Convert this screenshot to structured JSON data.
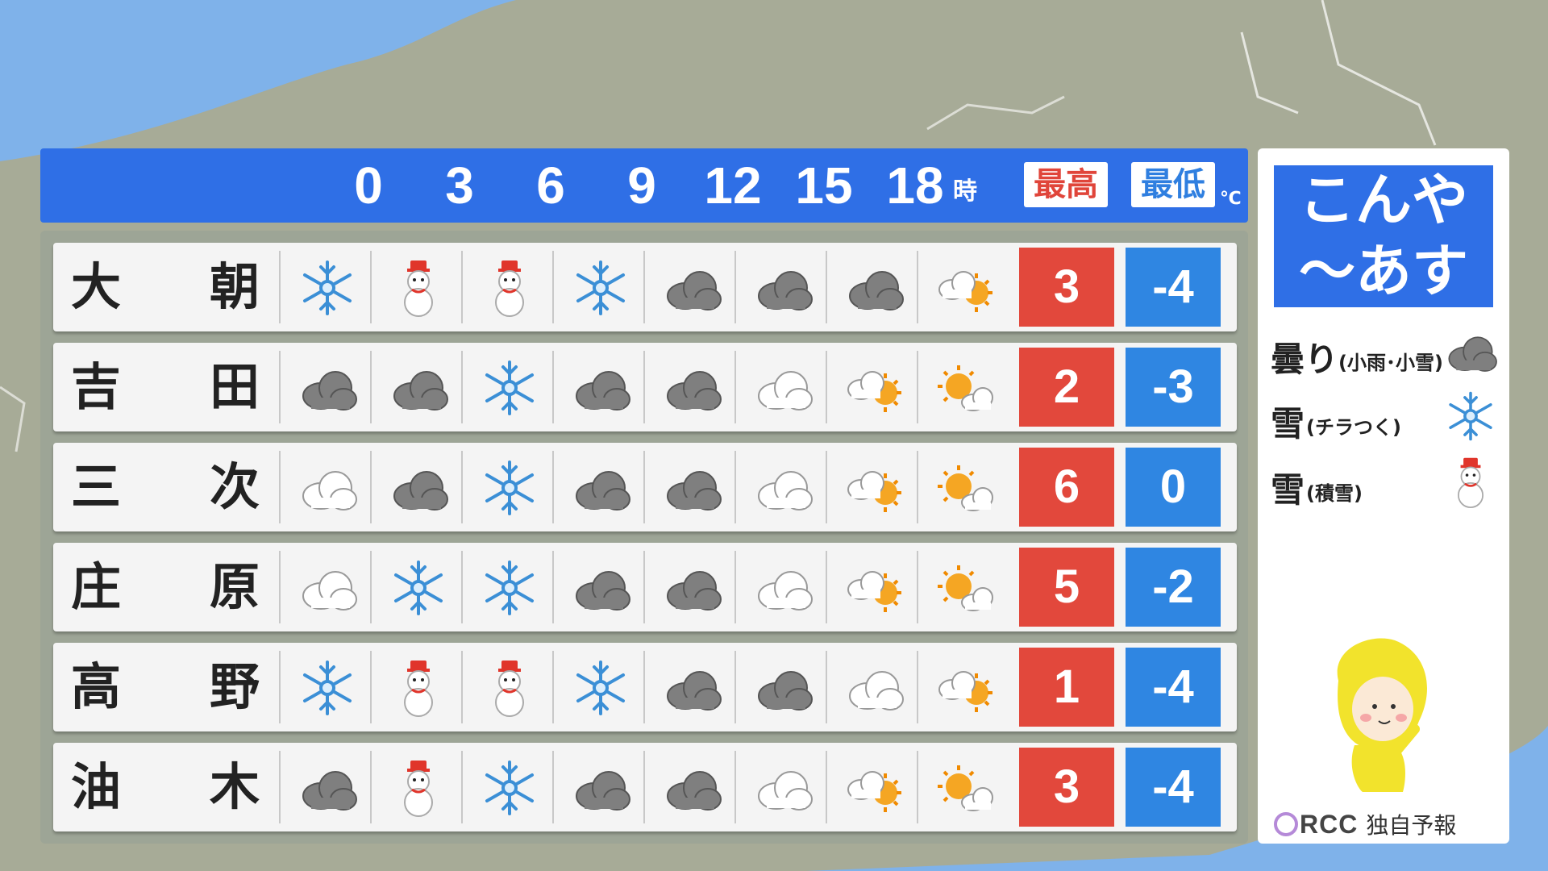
{
  "header": {
    "hours": [
      "0",
      "3",
      "6",
      "9",
      "12",
      "15",
      "18"
    ],
    "hour_unit": "時",
    "high_label": "最高",
    "low_label": "最低",
    "temp_unit": "℃"
  },
  "rows": [
    {
      "c1": "大",
      "c2": "朝",
      "icons": [
        "snow",
        "snowman",
        "snowman",
        "snow",
        "cloud",
        "cloud",
        "cloud",
        "cloud-sun"
      ],
      "high": "3",
      "low": "-4"
    },
    {
      "c1": "吉",
      "c2": "田",
      "icons": [
        "cloud",
        "cloud",
        "snow",
        "cloud",
        "cloud",
        "cloud-white",
        "cloud-sun",
        "sun-cloud"
      ],
      "high": "2",
      "low": "-3"
    },
    {
      "c1": "三",
      "c2": "次",
      "icons": [
        "cloud-white",
        "cloud",
        "snow",
        "cloud",
        "cloud",
        "cloud-white",
        "cloud-sun",
        "sun-cloud"
      ],
      "high": "6",
      "low": "0"
    },
    {
      "c1": "庄",
      "c2": "原",
      "icons": [
        "cloud-white",
        "snow",
        "snow",
        "cloud",
        "cloud",
        "cloud-white",
        "cloud-sun",
        "sun-cloud"
      ],
      "high": "5",
      "low": "-2"
    },
    {
      "c1": "高",
      "c2": "野",
      "icons": [
        "snow",
        "snowman",
        "snowman",
        "snow",
        "cloud",
        "cloud",
        "cloud-white",
        "cloud-sun"
      ],
      "high": "1",
      "low": "-4"
    },
    {
      "c1": "油",
      "c2": "木",
      "icons": [
        "cloud",
        "snowman",
        "snow",
        "cloud",
        "cloud",
        "cloud-white",
        "cloud-sun",
        "sun-cloud"
      ],
      "high": "3",
      "low": "-4"
    }
  ],
  "legend": {
    "title_line1": "こんや",
    "title_line2": "～あす",
    "items": [
      {
        "main": "曇り",
        "sub": "(小雨･小雪)",
        "icon": "cloud"
      },
      {
        "main": "雪",
        "sub": "(チラつく)",
        "icon": "snow"
      },
      {
        "main": "雪",
        "sub": "(積雪)",
        "icon": "snowman"
      }
    ],
    "logo_text": "RCC",
    "forecast_label": "独自予報"
  },
  "colors": {
    "header_blue": "#2f6fe6",
    "high_red": "#e2483c",
    "low_blue": "#2f86e2",
    "sea": "#7fb2ea",
    "land": "#a7ab97"
  }
}
